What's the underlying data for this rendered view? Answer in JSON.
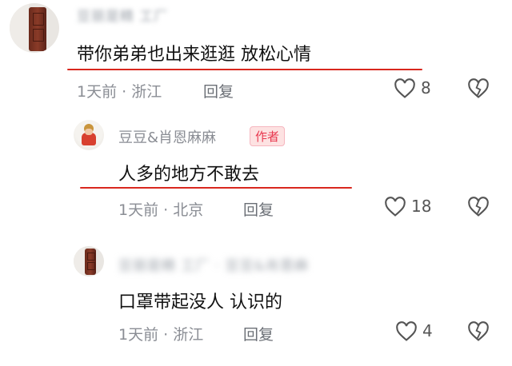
{
  "comments": [
    {
      "username": "豆丽是精 工厂",
      "text": "带你弟弟也出来逛逛 放松心情",
      "time_loc": "1天前 · 浙江",
      "reply_label": "回复",
      "likes": "8"
    },
    {
      "username": "豆豆&肖恩麻麻",
      "badge": "作者",
      "text": "人多的地方不敢去",
      "time_loc": "1天前 · 北京",
      "reply_label": "回复",
      "likes": "18"
    },
    {
      "username": "豆丽是精 工厂 · 豆豆&肖恩麻",
      "text": "口罩带起没人 认识的",
      "time_loc": "1天前 · 浙江",
      "reply_label": "回复",
      "likes": "4"
    }
  ],
  "colors": {
    "underline": "#d9271e",
    "badge_text": "#e8384f",
    "meta": "#8a8d94"
  },
  "icons": {
    "like": "heart-outline-icon",
    "dislike": "broken-heart-icon"
  }
}
